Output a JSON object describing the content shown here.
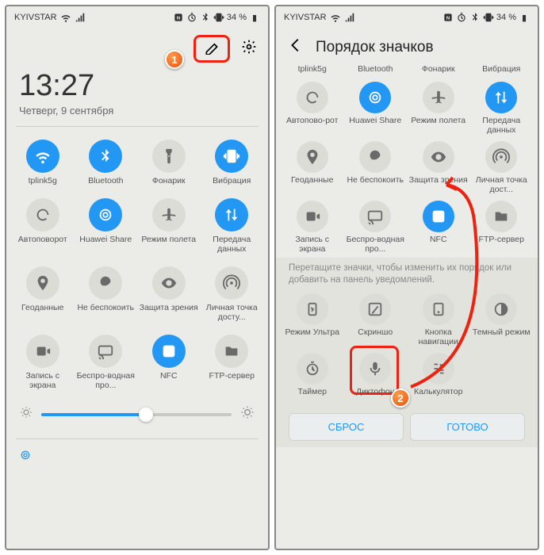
{
  "statusbar": {
    "carrier": "KYIVSTAR",
    "battery": "34 %"
  },
  "left": {
    "time": "13:27",
    "date": "Четверг, 9 сентября",
    "tiles": [
      {
        "label": "tplink5g",
        "icon": "wifi",
        "on": true
      },
      {
        "label": "Bluetooth",
        "icon": "bluetooth",
        "on": true
      },
      {
        "label": "Фонарик",
        "icon": "flashlight",
        "on": false
      },
      {
        "label": "Вибрация",
        "icon": "vibrate",
        "on": true
      },
      {
        "label": "Автоповорот",
        "icon": "rotate",
        "on": false
      },
      {
        "label": "Huawei Share",
        "icon": "share",
        "on": true
      },
      {
        "label": "Режим полета",
        "icon": "airplane",
        "on": false
      },
      {
        "label": "Передача данных",
        "icon": "data",
        "on": true
      },
      {
        "label": "Геоданные",
        "icon": "location",
        "on": false
      },
      {
        "label": "Не беспокоить",
        "icon": "dnd",
        "on": false
      },
      {
        "label": "Защита зрения",
        "icon": "eye",
        "on": false
      },
      {
        "label": "Личная точка досту...",
        "icon": "hotspot",
        "on": false
      },
      {
        "label": "Запись с экрана",
        "icon": "record",
        "on": false
      },
      {
        "label": "Беспро-водная про...",
        "icon": "cast",
        "on": false
      },
      {
        "label": "NFC",
        "icon": "nfc",
        "on": true
      },
      {
        "label": "FTP-сервер",
        "icon": "ftp",
        "on": false
      }
    ]
  },
  "right": {
    "title": "Порядок значков",
    "hint": "Перетащите значки, чтобы изменить их порядок или добавить на панель уведомлений.",
    "top_tiles_row0": [
      {
        "label": "tplink5g"
      },
      {
        "label": "Bluetooth"
      },
      {
        "label": "Фонарик"
      },
      {
        "label": "Вибрация"
      }
    ],
    "tiles": [
      {
        "label": "Автопово-рот",
        "icon": "rotate",
        "on": false
      },
      {
        "label": "Huawei Share",
        "icon": "share",
        "on": true
      },
      {
        "label": "Режим полета",
        "icon": "airplane",
        "on": false
      },
      {
        "label": "Передача данных",
        "icon": "data",
        "on": true
      },
      {
        "label": "Геоданные",
        "icon": "location",
        "on": false
      },
      {
        "label": "Не беспокоить",
        "icon": "dnd",
        "on": false
      },
      {
        "label": "Защита зрения",
        "icon": "eye",
        "on": false
      },
      {
        "label": "Личная точка дост...",
        "icon": "hotspot",
        "on": false
      },
      {
        "label": "Запись с экрана",
        "icon": "record",
        "on": false
      },
      {
        "label": "Беспро-водная про...",
        "icon": "cast",
        "on": false
      },
      {
        "label": "NFC",
        "icon": "nfc",
        "on": true
      },
      {
        "label": "FTP-сервер",
        "icon": "ftp",
        "on": false
      }
    ],
    "lower_tiles": [
      {
        "label": "Режим Ультра",
        "icon": "ultra"
      },
      {
        "label": "Скриншо",
        "icon": "screenshot"
      },
      {
        "label": "Кнопка навигации",
        "icon": "navbtn"
      },
      {
        "label": "Темный режим",
        "icon": "dark"
      },
      {
        "label": "Таймер",
        "icon": "timer"
      },
      {
        "label": "Диктофон",
        "icon": "mic"
      },
      {
        "label": "Калькулятор",
        "icon": "calc"
      }
    ],
    "reset": "СБРОС",
    "done": "ГОТОВО"
  },
  "callouts": {
    "1": "1",
    "2": "2"
  }
}
